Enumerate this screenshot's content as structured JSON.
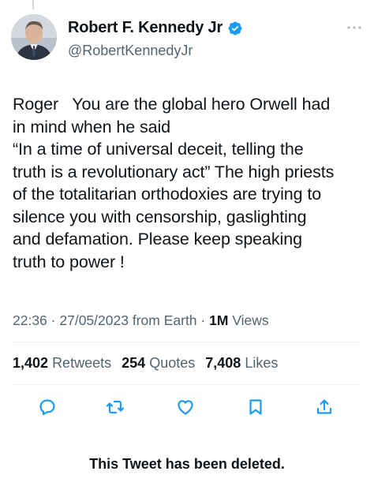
{
  "colors": {
    "verified_blue": "#1d9bf0",
    "secondary_text": "#536471",
    "primary_text": "#0f1419",
    "divider": "#eff3f4"
  },
  "author": {
    "display_name": "Robert F. Kennedy Jr",
    "handle": "@RobertKennedyJr",
    "verified_icon": "verified-badge-icon",
    "more_icon": "more-options-icon"
  },
  "tweet": {
    "text": "Roger   You are the global hero Orwell had\nin mind when he said\n“In a time of universal deceit, telling the\ntruth is a revolutionary act” The high priests\nof the totalitarian orthodoxies are trying to\nsilence you with censorship, gaslighting\nand defamation. Please keep speaking\ntruth to power !"
  },
  "meta": {
    "time": "22:36",
    "date": "27/05/2023",
    "source": "from Earth",
    "views_count": "1M",
    "views_label": "Views"
  },
  "stats": {
    "retweets_count": "1,402",
    "retweets_label": "Retweets",
    "quotes_count": "254",
    "quotes_label": "Quotes",
    "likes_count": "7,408",
    "likes_label": "Likes"
  },
  "actions": [
    "reply-icon",
    "retweet-icon",
    "like-icon",
    "bookmark-icon",
    "share-icon"
  ],
  "notice": "This Tweet has been deleted."
}
